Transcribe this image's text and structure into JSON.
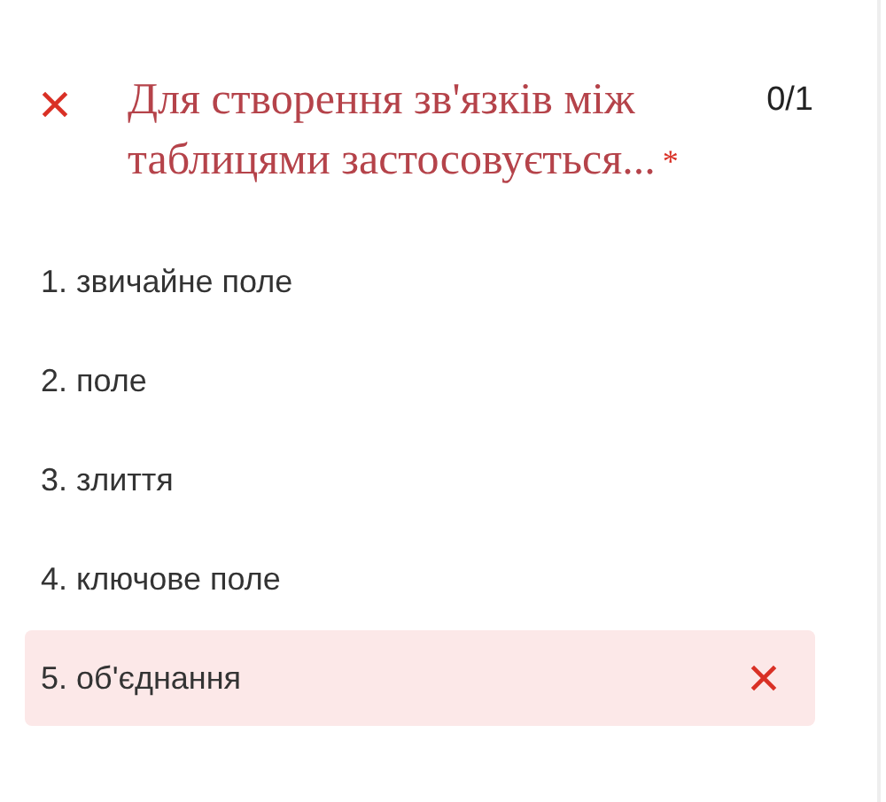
{
  "question": {
    "correct": false,
    "title": "Для створення зв'язків між таблицями застосовується...",
    "required_mark": "*",
    "score": "0/1"
  },
  "options": [
    {
      "label": "1. звичайне поле",
      "selected": false
    },
    {
      "label": "2. поле",
      "selected": false
    },
    {
      "label": "3. злиття",
      "selected": false
    },
    {
      "label": "4. ключове поле",
      "selected": false
    },
    {
      "label": "5. об'єднання",
      "selected": true
    }
  ]
}
